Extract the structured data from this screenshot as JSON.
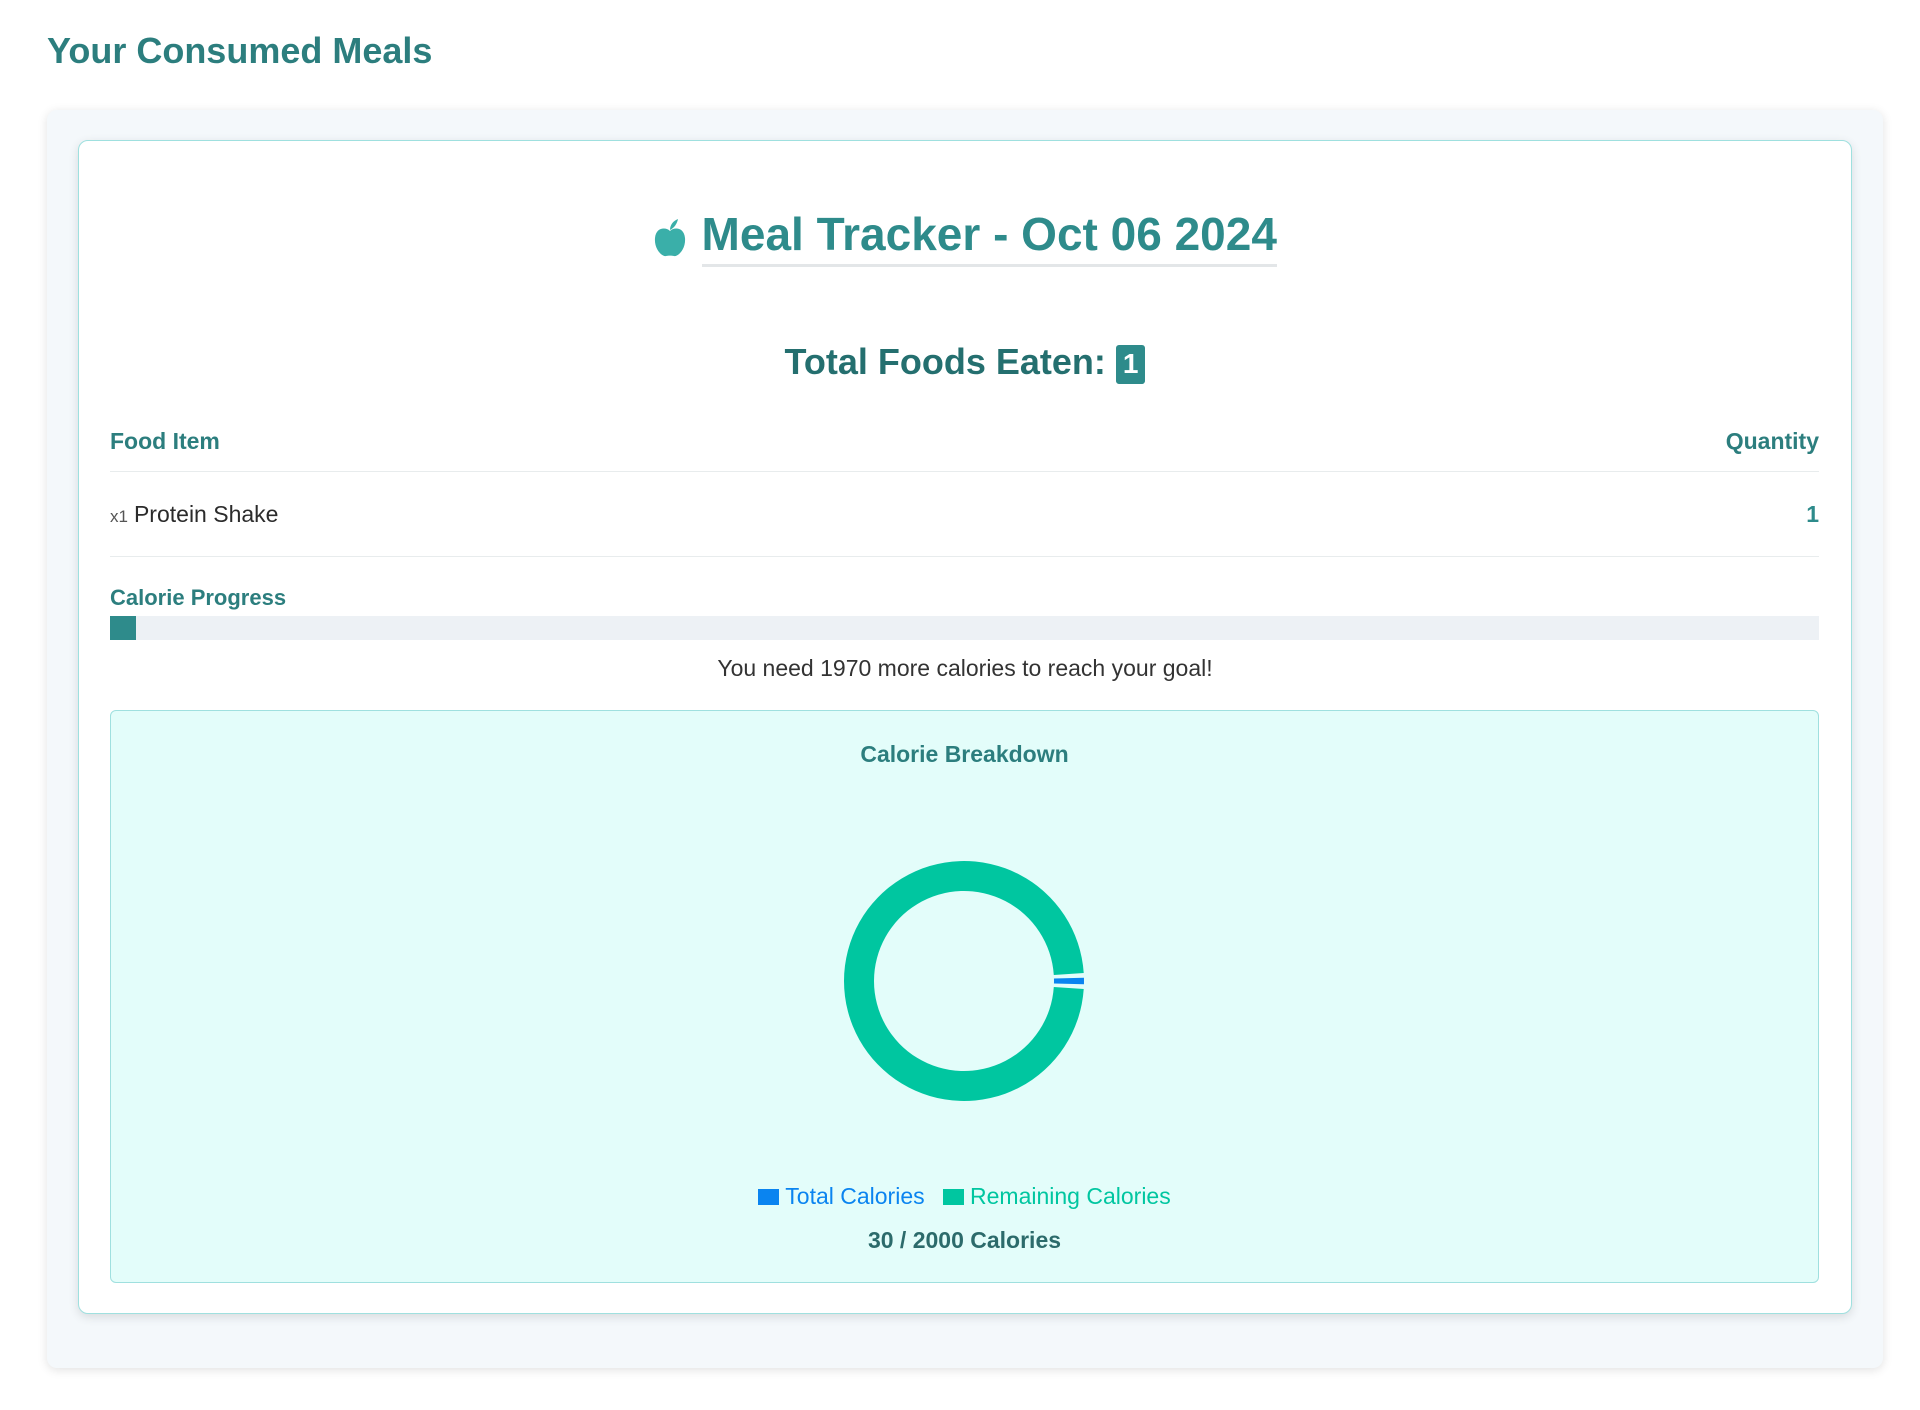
{
  "page": {
    "heading": "Your Consumed Meals"
  },
  "tracker": {
    "title": "Meal Tracker - Oct 06 2024",
    "icon": "apple-icon",
    "foods_label": "Total Foods Eaten:",
    "foods_count": "1"
  },
  "table": {
    "headers": {
      "food": "Food Item",
      "quantity": "Quantity"
    },
    "rows": [
      {
        "multiplier": "x1",
        "name": "Protein Shake",
        "quantity": "1"
      }
    ]
  },
  "progress": {
    "label": "Calorie Progress",
    "fraction": 0.015,
    "message": "You need 1970 more calories to reach your goal!"
  },
  "colors": {
    "accent": "#2e8b8b",
    "total_calories": "#0a84f0",
    "remaining_calories": "#00c6a0"
  },
  "chart_data": {
    "type": "pie",
    "title": "Calorie Breakdown",
    "categories": [
      "Total Calories",
      "Remaining Calories"
    ],
    "values": [
      30,
      1970
    ],
    "legend": "bottom",
    "summary": "30 / 2000 Calories"
  }
}
